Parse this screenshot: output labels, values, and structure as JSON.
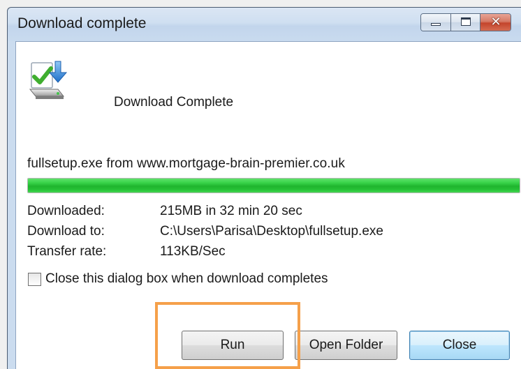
{
  "window": {
    "title": "Download complete",
    "caption_icons": [
      "minimize-icon",
      "maximize-icon",
      "close-icon"
    ],
    "close_glyph": "✕"
  },
  "header": {
    "icon": "download-complete-icon",
    "text": "Download Complete"
  },
  "source": {
    "line": "fullsetup.exe from www.mortgage-brain-premier.co.uk"
  },
  "progress": {
    "percent": 100,
    "color": "#22c832"
  },
  "details": [
    {
      "label": "Downloaded:",
      "value": "215MB in 32 min 20 sec"
    },
    {
      "label": "Download to:",
      "value": "C:\\Users\\Parisa\\Desktop\\fullsetup.exe"
    },
    {
      "label": "Transfer rate:",
      "value": "113KB/Sec"
    }
  ],
  "options": {
    "close_when_complete_label": "Close this dialog box when download completes",
    "close_when_complete_checked": false
  },
  "buttons": {
    "run": "Run",
    "open_folder": "Open Folder",
    "close": "Close"
  },
  "annotation": {
    "highlight_color": "#f5a04a"
  }
}
